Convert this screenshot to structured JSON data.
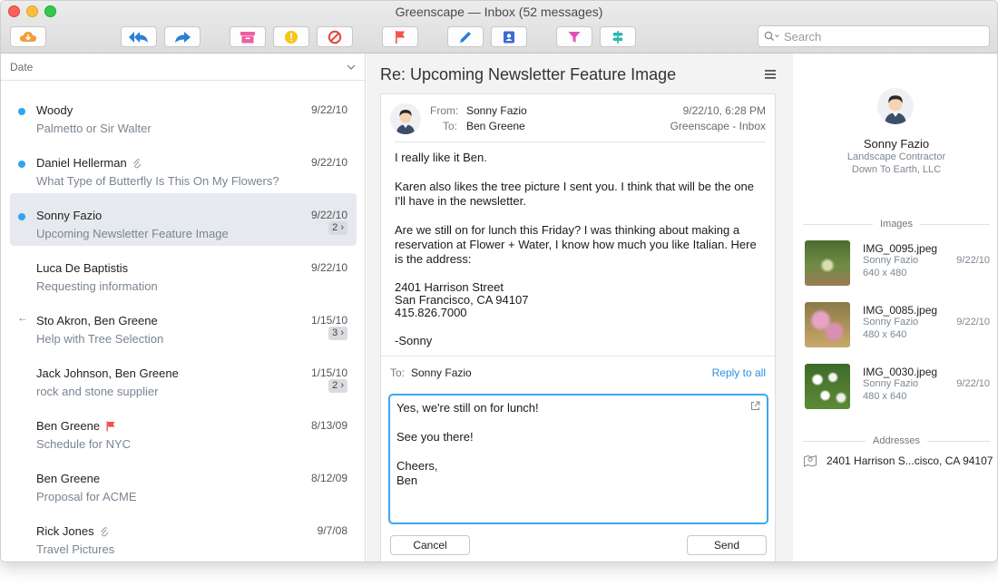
{
  "window": {
    "title": "Greenscape — Inbox (52 messages)"
  },
  "toolbar": {
    "search_placeholder": "Search",
    "colors": {
      "accent": "#2fa6ef",
      "flag": "#f0534d",
      "orange": "#f39c3a",
      "pink": "#ec5fa0",
      "yellow": "#f5c518",
      "red": "#e8443c",
      "blue": "#2b7fd8",
      "indigo": "#3f6bd1",
      "magenta": "#e24fb4",
      "teal": "#2fb8b0"
    },
    "buttons": [
      "get-mail",
      "reply-all",
      "forward",
      "archive",
      "junk",
      "block",
      "flag",
      "compose",
      "contacts",
      "filter",
      "rules"
    ]
  },
  "list": {
    "sort_label": "Date",
    "messages": [
      {
        "from": "Woody",
        "subject": "Palmetto or Sir Walter",
        "date": "9/22/10",
        "unread": true
      },
      {
        "from": "Daniel Hellerman",
        "subject": "What Type of Butterfly Is This On My Flowers?",
        "date": "9/22/10",
        "unread": true,
        "attachment": true
      },
      {
        "from": "Sonny Fazio",
        "subject": "Upcoming Newsletter Feature Image",
        "date": "9/22/10",
        "unread": true,
        "selected": true,
        "count": "2"
      },
      {
        "from": "Luca De Baptistis",
        "subject": "Requesting information",
        "date": "9/22/10"
      },
      {
        "from": "Sto Akron, Ben Greene",
        "subject": "Help with Tree Selection",
        "date": "1/15/10",
        "replied": true,
        "count": "3"
      },
      {
        "from": "Jack Johnson, Ben Greene",
        "subject": "rock and stone supplier",
        "date": "1/15/10",
        "count": "2"
      },
      {
        "from": "Ben Greene",
        "subject": "Schedule for NYC",
        "date": "8/13/09",
        "flagged": true
      },
      {
        "from": "Ben Greene",
        "subject": "Proposal for ACME",
        "date": "8/12/09"
      },
      {
        "from": "Rick Jones",
        "subject": "Travel Pictures",
        "date": "9/7/08",
        "attachment": true
      }
    ]
  },
  "message": {
    "subject": "Re: Upcoming Newsletter Feature Image",
    "from_label": "From:",
    "from": "Sonny Fazio",
    "to_label": "To:",
    "to": "Ben Greene",
    "datetime": "9/22/10, 6:28 PM",
    "mailbox": "Greenscape - Inbox",
    "body": [
      "I really like it Ben.",
      "Karen also likes the tree picture I sent you.  I think that will be the one I'll have in the newsletter.",
      "Are we still on for lunch this Friday? I was thinking about making a reservation at Flower + Water, I know how much you like Italian. Here is the address:"
    ],
    "address_lines": [
      "2401 Harrison Street",
      "San Francisco, CA  94107",
      "415.826.7000"
    ],
    "signoff": "-Sonny"
  },
  "reply": {
    "to_label": "To:",
    "to": "Sonny Fazio",
    "reply_all_label": "Reply to all",
    "lines": [
      "Yes, we're still on for lunch!",
      "See you there!",
      "Cheers,",
      "Ben"
    ],
    "cancel_label": "Cancel",
    "send_label": "Send"
  },
  "contact": {
    "name": "Sonny Fazio",
    "title": "Landscape Contractor",
    "company": "Down To Earth, LLC",
    "images_heading": "Images",
    "images": [
      {
        "name": "IMG_0095.jpeg",
        "sender": "Sonny Fazio",
        "dims": "640 x 480",
        "date": "9/22/10"
      },
      {
        "name": "IMG_0085.jpeg",
        "sender": "Sonny Fazio",
        "dims": "480 x 640",
        "date": "9/22/10"
      },
      {
        "name": "IMG_0030.jpeg",
        "sender": "Sonny Fazio",
        "dims": "480 x 640",
        "date": "9/22/10"
      }
    ],
    "addresses_heading": "Addresses",
    "address": "2401 Harrison S...cisco, CA 94107"
  }
}
